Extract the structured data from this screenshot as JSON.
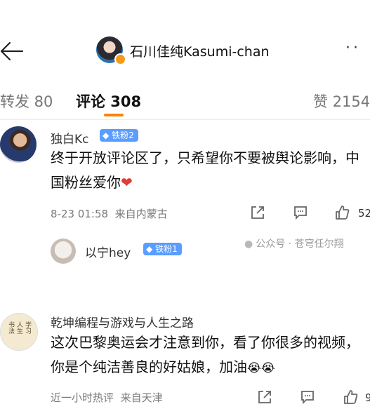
{
  "header": {
    "title": "石川佳纯Kasumi-chan",
    "back_icon": "back-arrow-icon",
    "more_icon": "more-horizontal-icon",
    "more_glyph": "··"
  },
  "tabs": {
    "repost": "转发 80",
    "comments": "评论 308",
    "likes": "赞 2154",
    "accent_color": "#ff8200"
  },
  "comments": [
    {
      "username": "独白Kc",
      "fan_badge": "铁粉2",
      "text": "终于开放评论区了，只希望你不要被舆论影响，中国粉丝爱你",
      "heart": "❤",
      "timestamp": "8-23 01:58",
      "location": "来自内蒙古",
      "like_count": "52",
      "reply_preview": {
        "username": "以宁hey",
        "fan_badge": "铁粉1"
      }
    },
    {
      "username": "乾坤编程与游戏与人生之路",
      "text": "这次巴黎奥运会才注意到你，看了你很多的视频，你是个纯洁善良的好姑娘，加油",
      "emoji": "😭😭",
      "timestamp": "近一小时热评",
      "location": "来自天津",
      "like_count": "9"
    }
  ],
  "watermark": {
    "text": "公众号 · 苍穹任尔翔",
    "icon": "wechat-icon"
  },
  "badge_color": "#5b9dff"
}
